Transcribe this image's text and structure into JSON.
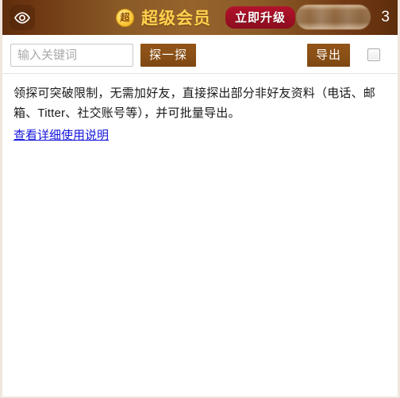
{
  "header": {
    "eye_icon": "eye-icon",
    "vip": {
      "badge_char": "超",
      "label": "超级会员",
      "upgrade_label": "立即升级"
    },
    "username_redacted": "",
    "message_count": "3",
    "colors": {
      "bar_dark": "#5e2d0c",
      "bar_light": "#96632c",
      "vip_gold": "#ffd24d",
      "upgrade_red": "#9d0f24"
    }
  },
  "toolbar": {
    "search_placeholder": "输入关键词",
    "search_value": "",
    "probe_label": "探一探",
    "export_label": "导出",
    "export_checkbox_checked": false,
    "button_color": "#8a5016"
  },
  "content": {
    "description": "领探可突破限制，无需加好友，直接探出部分非好友资料（电话、邮箱、Titter、社交账号等），并可批量导出。",
    "help_link": "查看详细使用说明",
    "link_color": "#1414dc"
  }
}
